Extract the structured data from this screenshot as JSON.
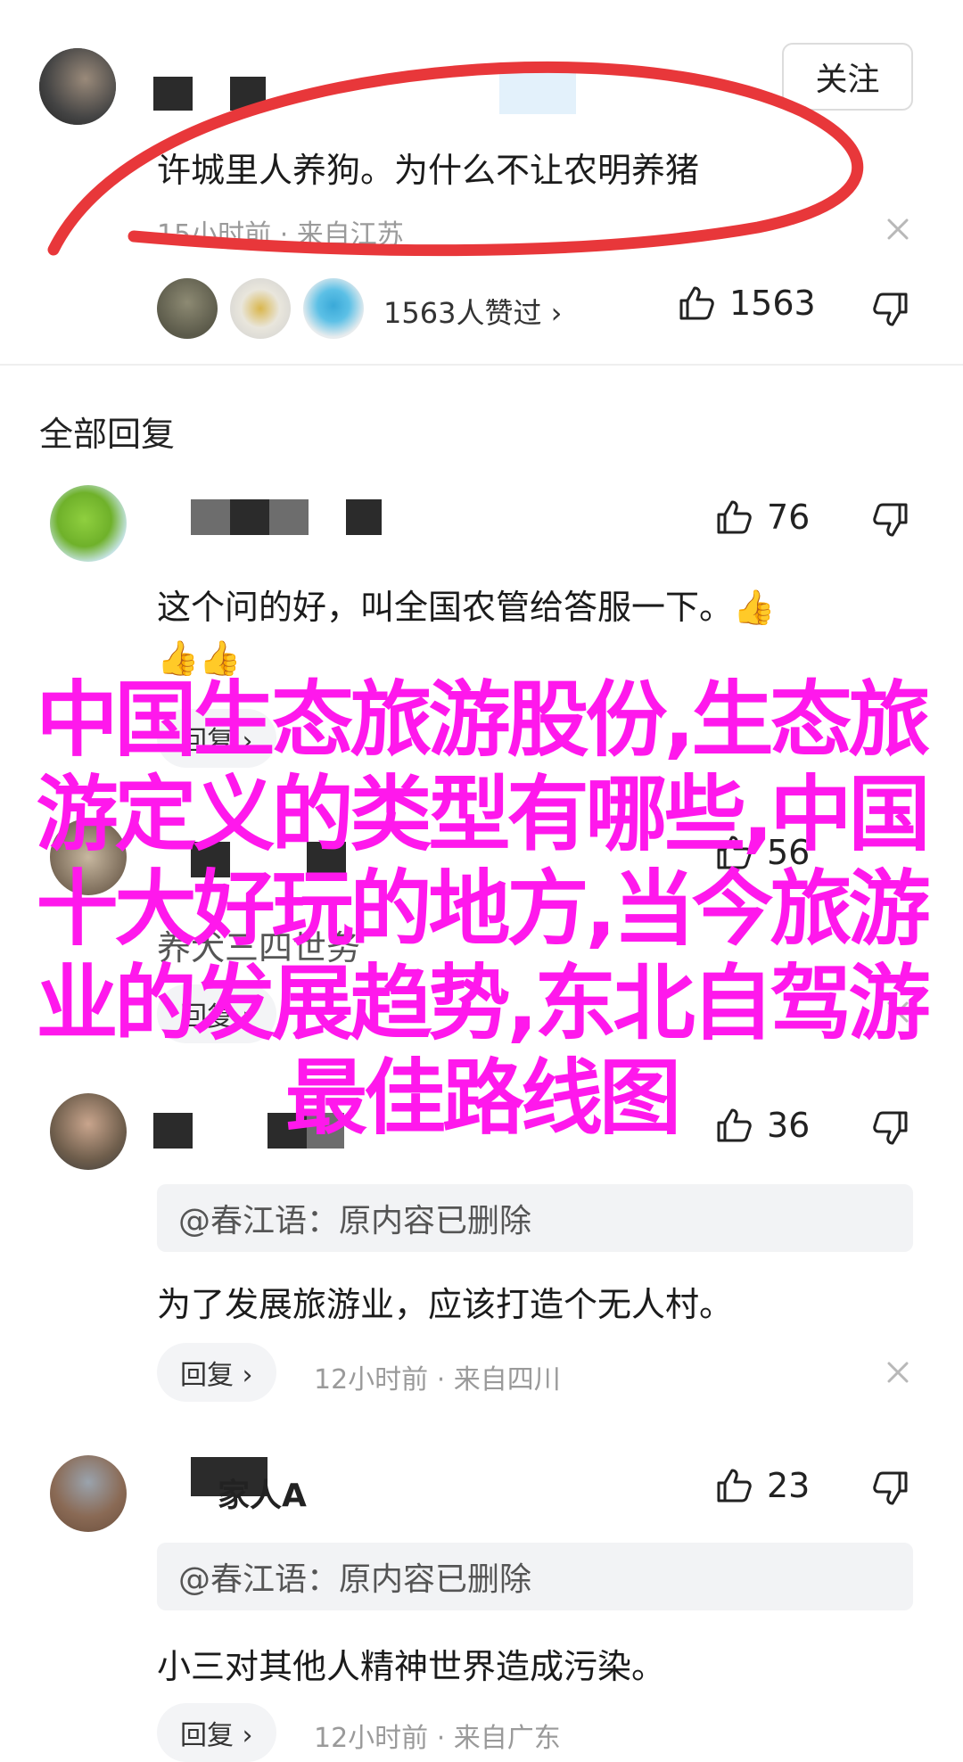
{
  "top_comment": {
    "follow_label": "关注",
    "text": "许城里人养狗。为什么不让农明养猪",
    "meta": "15小时前 · 来自江苏",
    "likers_label": "1563人赞过 ›",
    "like_count": "1563"
  },
  "section_title": "全部回复",
  "replies": [
    {
      "like_count": "76",
      "text_line1": "这个问的好，叫全国农管给答服一下。👍",
      "text_line2": "👍👍",
      "reply_label": "回复 ›"
    },
    {
      "like_count": "56",
      "text": "养犬三四世务",
      "reply_label": "回复 ›"
    },
    {
      "like_count": "36",
      "quote": "@春江语：原内容已删除",
      "text": "为了发展旅游业，应该打造个无人村。",
      "reply_label": "回复 ›",
      "meta": "12小时前 · 来自四川"
    },
    {
      "name_suffix": "家人A",
      "like_count": "23",
      "quote": "@春江语：原内容已删除",
      "text": "小三对其他人精神世界造成污染。",
      "reply_label": "回复 ›",
      "meta": "12小时前 · 来自广东"
    }
  ],
  "overlay_text": "中国生态旅游股份,生态旅游定义的类型有哪些,中国十大好玩的地方,当今旅游业的发展趋势,东北自驾游最佳路线图",
  "colors": {
    "overlay": "#ff18ec",
    "annotation_circle": "#e8373a",
    "meta_text": "#9a9a9a"
  }
}
